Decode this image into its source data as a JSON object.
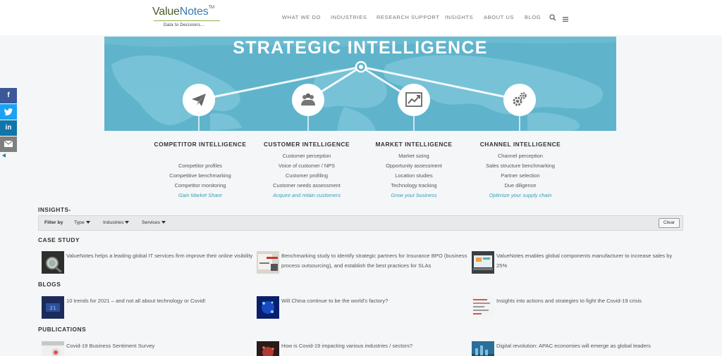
{
  "header": {
    "logo": {
      "main_a": "Value",
      "main_b": "Notes",
      "tm": "TM",
      "tagline": "Data  to  Decisions..."
    },
    "nav": [
      "WHAT WE DO",
      "INDUSTRIES",
      "RESEARCH SUPPORT",
      "INSIGHTS",
      "ABOUT US",
      "BLOG"
    ],
    "icons": {
      "search": "search-icon",
      "menu": "hamburger-menu-icon"
    }
  },
  "hero": {
    "title": "STRATEGIC INTELLIGENCE",
    "bg_color": "#5fb4cc"
  },
  "columns": [
    {
      "title": "COMPETITOR INTELLIGENCE",
      "items": [
        "Competitor profiles",
        "Competitive benchmarking",
        "Competitor monitoring"
      ],
      "tagline": "Gain Market Share",
      "icon": "paper-plane-icon"
    },
    {
      "title": "CUSTOMER INTELLIGENCE",
      "items": [
        "Customer perception",
        "Voice of customer / NPS",
        "Customer profiling",
        "Customer needs assessment"
      ],
      "tagline": "Acquire and retain customers",
      "icon": "people-group-icon"
    },
    {
      "title": "MARKET INTELLIGENCE",
      "items": [
        "Market sizing",
        "Opportunity assessment",
        "Location studies",
        "Technology tracking"
      ],
      "tagline": "Grow your business",
      "icon": "trend-chart-icon"
    },
    {
      "title": "CHANNEL INTELLIGENCE",
      "items": [
        "Channel perception",
        "Sales structure benchmarking",
        "Partner selection",
        "Due diligence"
      ],
      "tagline": "Optimize your supply chain",
      "icon": "gears-icon"
    }
  ],
  "insights": {
    "title": "INSIGHTS-",
    "filter": {
      "label": "Filter by",
      "dropdowns": [
        "Type",
        "Industries",
        "Services"
      ],
      "clear": "Clear"
    },
    "sections": [
      {
        "title": "CASE STUDY",
        "items": [
          "ValueNotes helps a leading global IT services firm improve their online visibility",
          "Benchmarking study to identify strategic partners for Insurance BPO (business process outsourcing), and establish the best practices for SLAs",
          "ValueNotes enables global components manufacturer to increase sales by 25%"
        ]
      },
      {
        "title": "BLOGS",
        "items": [
          "10 trends for 2021 – and not all about technology or Covid!",
          "Will China continue to be the world's factory?",
          "Insights into actions and strategies to fight the Covid-19 crisis"
        ]
      },
      {
        "title": "PUBLICATIONS",
        "items": [
          "Covid-19 Business Sentiment Survey",
          "How is Covid-19 impacting various industries / sectors?",
          "Digital revolution: APAC economies will emerge as global leaders"
        ]
      }
    ]
  },
  "social": [
    {
      "label": "f",
      "color": "#3b5998",
      "icon": "facebook-icon"
    },
    {
      "label": "t",
      "color": "#1da1f2",
      "icon": "twitter-icon"
    },
    {
      "label": "in",
      "color": "#0e76a8",
      "icon": "linkedin-icon"
    },
    {
      "label": "✉",
      "color": "#7f7f7f",
      "icon": "email-icon"
    }
  ]
}
